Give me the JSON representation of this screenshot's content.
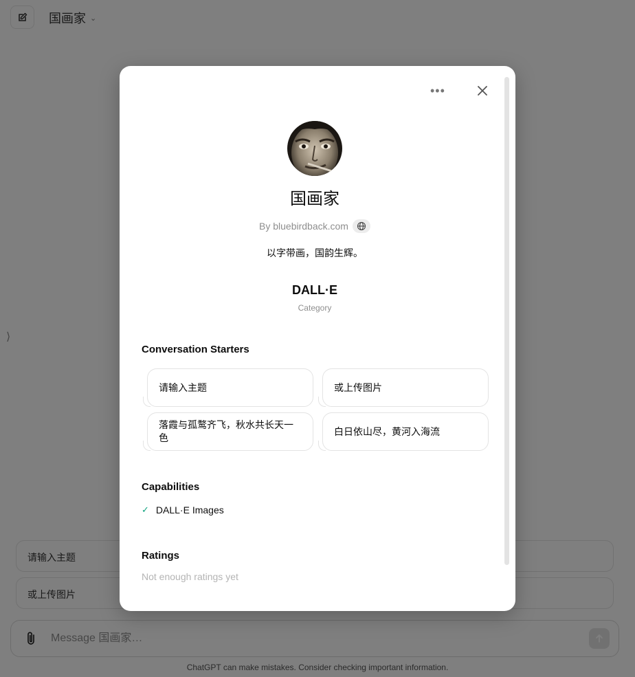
{
  "app": {
    "title": "国画家",
    "chevron": "⌄",
    "sidebar_toggle": "⟩"
  },
  "background_starters": [
    "请输入主题",
    "或上传图片"
  ],
  "composer": {
    "placeholder": "Message 国画家…"
  },
  "footer_note": "ChatGPT can make mistakes. Consider checking important information.",
  "modal": {
    "more_label": "•••",
    "name": "国画家",
    "author": "By bluebirdback.com",
    "description": "以字带画，国韵生辉。",
    "category_value": "DALL·E",
    "category_label": "Category",
    "starters_title": "Conversation Starters",
    "starters": [
      "请输入主题",
      "或上传图片",
      "落霞与孤鹜齐飞，秋水共长天一色",
      "白日依山尽，黄河入海流"
    ],
    "capabilities_title": "Capabilities",
    "capabilities": [
      "DALL·E Images"
    ],
    "check_mark": "✓",
    "ratings_title": "Ratings",
    "ratings_text": "Not enough ratings yet"
  },
  "colors": {
    "overlay": "rgba(0,0,0,0.5)",
    "check": "#10a37f",
    "muted_text": "#8e8e8e"
  },
  "icons": [
    "new-chat-icon",
    "chevron-down-icon",
    "paperclip-icon",
    "arrow-up-icon",
    "more-icon",
    "close-icon",
    "globe-icon",
    "check-icon"
  ]
}
